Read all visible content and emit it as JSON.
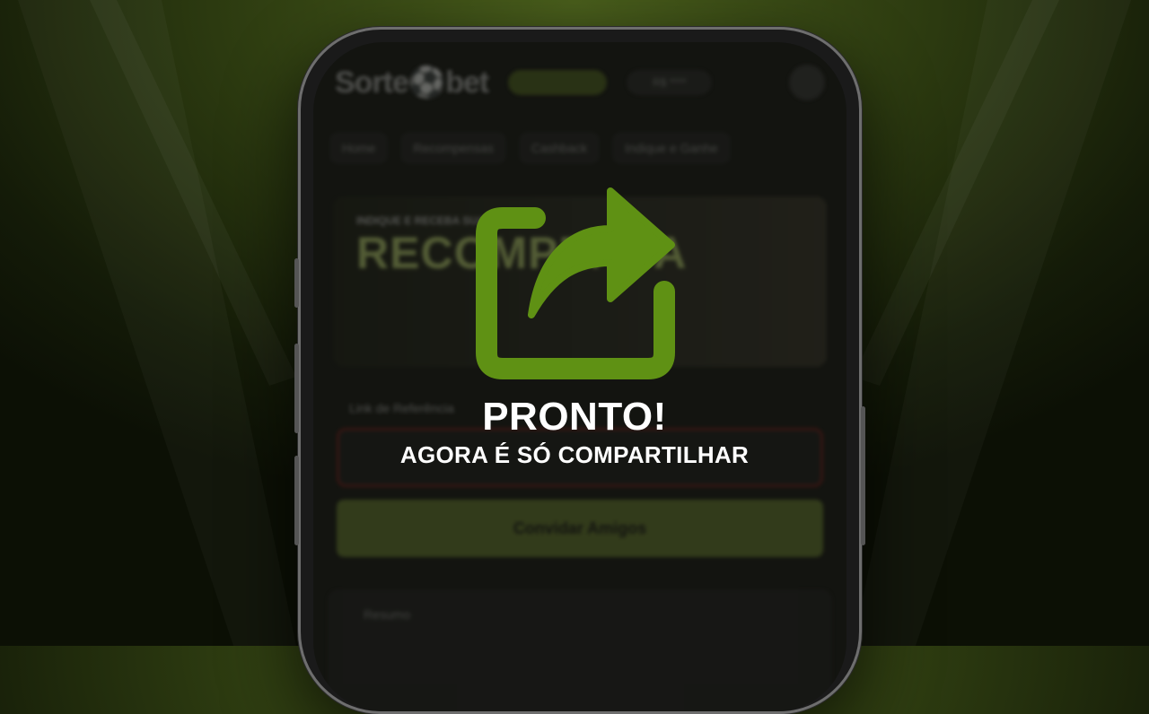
{
  "app": {
    "logo_text": "Sorte⚽bet",
    "balance_text": "R$ ****",
    "nav_items": [
      "Home",
      "Recompensas",
      "Cashback",
      "Indique e Ganhe"
    ],
    "banner_line1": "INDIQUE E RECEBA SUA",
    "banner_line2": "RECOMPENSA",
    "referral_label": "Link de Referência",
    "invite_button": "Convidar Amigos",
    "summary_label": "Resumo"
  },
  "overlay": {
    "title": "PRONTO!",
    "subtitle": "AGORA É SÓ COMPARTILHAR",
    "icon": "share-icon"
  },
  "colors": {
    "accent": "#5f9114",
    "text": "#ffffff",
    "background": "#2c3a10"
  }
}
